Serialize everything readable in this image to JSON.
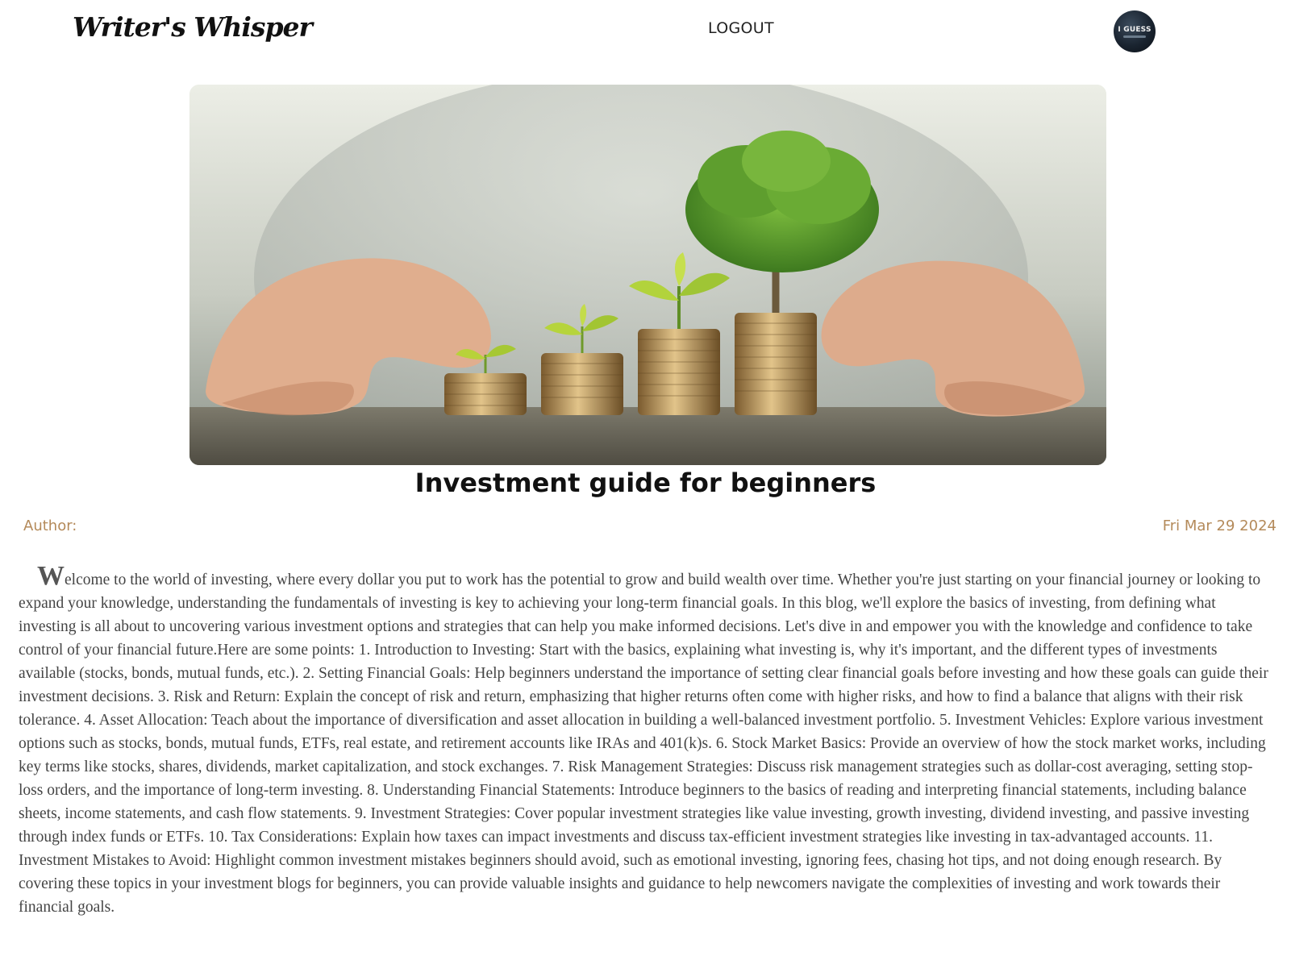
{
  "navbar": {
    "logo": "Writer's Whisper",
    "logout_label": "LOGOUT",
    "avatar_text": "I GUESS"
  },
  "post": {
    "hero_image": "coins-and-growing-plants-photo",
    "title": "Investment guide for beginners",
    "author_label": "Author:",
    "date": "Fri Mar 29 2024",
    "dropcap": "W",
    "body": "elcome to the world of investing, where every dollar you put to work has the potential to grow and build wealth over time. Whether you're just starting on your financial journey or looking to expand your knowledge, understanding the fundamentals of investing is key to achieving your long-term financial goals. In this blog, we'll explore the basics of investing, from defining what investing is all about to uncovering various investment options and strategies that can help you make informed decisions. Let's dive in and empower you with the knowledge and confidence to take control of your financial future.Here are some points: 1. Introduction to Investing: Start with the basics, explaining what investing is, why it's important, and the different types of investments available (stocks, bonds, mutual funds, etc.). 2. Setting Financial Goals: Help beginners understand the importance of setting clear financial goals before investing and how these goals can guide their investment decisions. 3. Risk and Return: Explain the concept of risk and return, emphasizing that higher returns often come with higher risks, and how to find a balance that aligns with their risk tolerance. 4. Asset Allocation: Teach about the importance of diversification and asset allocation in building a well-balanced investment portfolio. 5. Investment Vehicles: Explore various investment options such as stocks, bonds, mutual funds, ETFs, real estate, and retirement accounts like IRAs and 401(k)s. 6. Stock Market Basics: Provide an overview of how the stock market works, including key terms like stocks, shares, dividends, market capitalization, and stock exchanges. 7. Risk Management Strategies: Discuss risk management strategies such as dollar-cost averaging, setting stop-loss orders, and the importance of long-term investing. 8. Understanding Financial Statements: Introduce beginners to the basics of reading and interpreting financial statements, including balance sheets, income statements, and cash flow statements. 9. Investment Strategies: Cover popular investment strategies like value investing, growth investing, dividend investing, and passive investing through index funds or ETFs. 10. Tax Considerations: Explain how taxes can impact investments and discuss tax-efficient investment strategies like investing in tax-advantaged accounts. 11. Investment Mistakes to Avoid: Highlight common investment mistakes beginners should avoid, such as emotional investing, ignoring fees, chasing hot tips, and not doing enough research. By covering these topics in your investment blogs for beginners, you can provide valuable insights and guidance to help newcomers navigate the complexities of investing and work towards their financial goals."
  },
  "colors": {
    "accent": "#b48a5a",
    "body_text": "#444444",
    "title": "#111111"
  }
}
